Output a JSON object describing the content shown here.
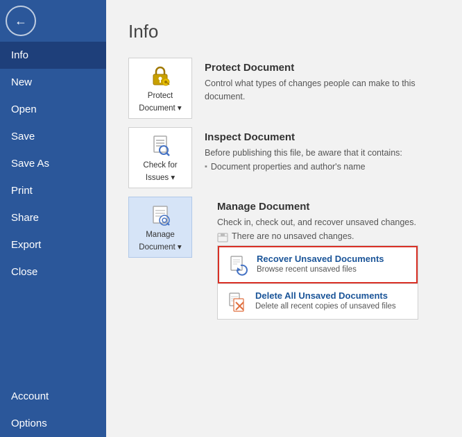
{
  "sidebar": {
    "back_icon": "←",
    "items": [
      {
        "id": "info",
        "label": "Info",
        "active": true
      },
      {
        "id": "new",
        "label": "New",
        "active": false
      },
      {
        "id": "open",
        "label": "Open",
        "active": false
      },
      {
        "id": "save",
        "label": "Save",
        "active": false
      },
      {
        "id": "save-as",
        "label": "Save As",
        "active": false
      },
      {
        "id": "print",
        "label": "Print",
        "active": false
      },
      {
        "id": "share",
        "label": "Share",
        "active": false
      },
      {
        "id": "export",
        "label": "Export",
        "active": false
      },
      {
        "id": "close",
        "label": "Close",
        "active": false
      },
      {
        "id": "account",
        "label": "Account",
        "active": false
      },
      {
        "id": "options",
        "label": "Options",
        "active": false
      }
    ]
  },
  "page": {
    "title": "Info"
  },
  "sections": {
    "protect": {
      "btn_line1": "Protect",
      "btn_line2": "Document ▾",
      "title": "Protect Document",
      "desc": "Control what types of changes people can make to this document."
    },
    "inspect": {
      "btn_line1": "Check for",
      "btn_line2": "Issues ▾",
      "title": "Inspect Document",
      "desc": "Before publishing this file, be aware that it contains:",
      "bullets": [
        "Document properties and author's name"
      ]
    },
    "manage": {
      "btn_line1": "Manage",
      "btn_line2": "Document ▾",
      "title": "Manage Document",
      "desc": "Check in, check out, and recover unsaved changes.",
      "sub_desc": "There are no unsaved changes."
    }
  },
  "dropdown": {
    "recover": {
      "title": "Recover Unsaved Documents",
      "desc": "Browse recent unsaved files"
    },
    "delete": {
      "title": "Delete All Unsaved Documents",
      "desc": "Delete all recent copies of unsaved files"
    }
  },
  "colors": {
    "sidebar_bg": "#2b579a",
    "active_item": "#1e3f7a",
    "accent": "#2b579a",
    "highlight_border": "#d93025",
    "link_blue": "#1a5498"
  }
}
